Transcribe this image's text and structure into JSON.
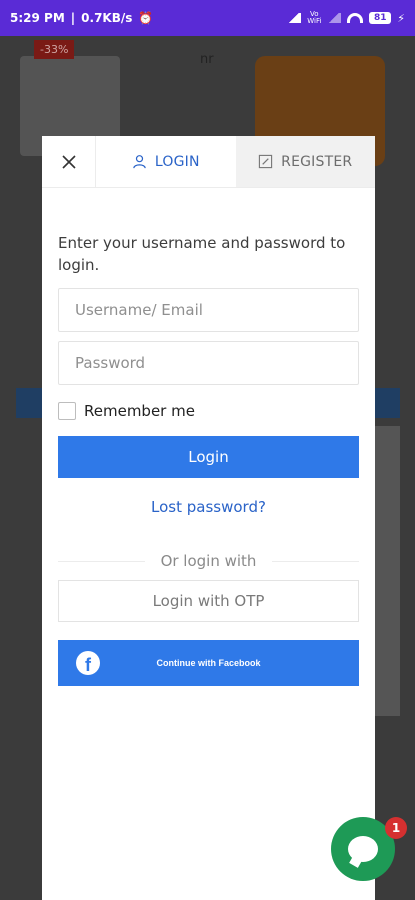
{
  "status_bar": {
    "time": "5:29 PM",
    "speed": "0.7KB/s",
    "vowifi": "Vo WiFi",
    "battery": "81"
  },
  "background": {
    "discount_badge": "-33%",
    "partial_text": "nr"
  },
  "tabs": {
    "login": "LOGIN",
    "register": "REGISTER"
  },
  "form": {
    "intro": "Enter your username and password to login.",
    "username_placeholder": "Username/ Email",
    "password_placeholder": "Password",
    "remember_label": "Remember me",
    "login_button": "Login",
    "lost_password": "Lost password?",
    "or_login_with": "Or login with",
    "otp_button": "Login with OTP",
    "facebook_button": "Continue with Facebook"
  },
  "chat": {
    "badge_count": "1"
  },
  "colors": {
    "accent": "#2f79e8",
    "status_bar": "#5a2bd6",
    "chat": "#1e9a56",
    "badge": "#d53030"
  }
}
